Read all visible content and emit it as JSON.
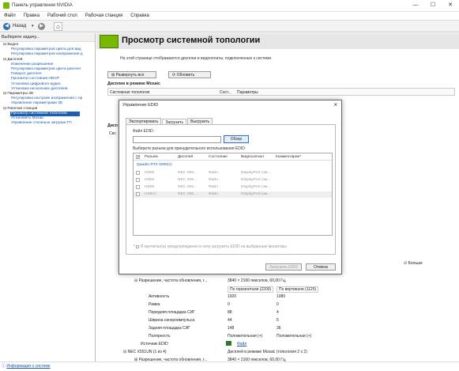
{
  "window": {
    "title": "Панель управления NVIDIA",
    "min": "—",
    "max": "☐",
    "close": "✕"
  },
  "menu": [
    "Файл",
    "Правка",
    "Рабочий стол",
    "Рабочая станция",
    "Справка"
  ],
  "toolbar": {
    "back_label": "Назад"
  },
  "sidebar": {
    "header": "Выберите задачу...",
    "tree": [
      {
        "kind": "cat",
        "label": "⊟ Видео"
      },
      {
        "kind": "item",
        "label": "Регулировка параметров цвета для вид"
      },
      {
        "kind": "item",
        "label": "Регулировка параметров изображения д"
      },
      {
        "kind": "cat",
        "label": "⊟ Дисплей"
      },
      {
        "kind": "item",
        "label": "Изменение разрешения"
      },
      {
        "kind": "item",
        "label": "Регулировка параметров цвета рабочег"
      },
      {
        "kind": "item",
        "label": "Поворот дисплея"
      },
      {
        "kind": "item",
        "label": "Просмотр состояния HDCP"
      },
      {
        "kind": "item",
        "label": "Установка цифрового аудио"
      },
      {
        "kind": "item",
        "label": "Установка нескольких дисплеев"
      },
      {
        "kind": "cat",
        "label": "⊟ Параметры 3D"
      },
      {
        "kind": "item",
        "label": "Регулировка настроек изображения с пр"
      },
      {
        "kind": "item",
        "label": "Управление параметрами 3D"
      },
      {
        "kind": "cat",
        "label": "⊟ Рабочая станция"
      },
      {
        "kind": "sel",
        "label": "Просмотр системной топологии"
      },
      {
        "kind": "item",
        "label": "Установить Mosaic"
      },
      {
        "kind": "item",
        "label": "Управление степенью загрузки ГП"
      }
    ],
    "system_info": "Информация о системе"
  },
  "main": {
    "title": "Просмотр системной топологии",
    "description": "На этой странице отображаются дисплеи и видеоплаты, подключенные к системе.",
    "expand_all": "Развернуть все",
    "refresh": "Обновить",
    "mosaic_section": "Дисплеи в режиме Mosaic",
    "cols": [
      "Системная топология",
      "Сост...",
      "Параметры"
    ],
    "section2_prefix": "Дисп",
    "col2_prefix": "Сис",
    "more": "Больше",
    "rows": [
      {
        "label": "⊟ Разрешение, частота обновления, г...",
        "v1": "3840 × 2160 пикселов, 60,00 Гц,",
        "v2": ""
      },
      {
        "label": "",
        "v1": "По горизонтали (2200)",
        "v2": "По вертикали (1125)"
      },
      {
        "label": "Активность",
        "v1": "1920",
        "v2": "1080"
      },
      {
        "label": "Рамка",
        "v1": "0",
        "v2": "0"
      },
      {
        "label": "Передняя площадка СИГ",
        "v1": "88",
        "v2": "4"
      },
      {
        "label": "Ширина синхроимпульса",
        "v1": "44",
        "v2": "5"
      },
      {
        "label": "Задняя площадка СИГ",
        "v1": "148",
        "v2": "36"
      },
      {
        "label": "Полярность",
        "v1": "Положительная (+)",
        "v2": "Положительная (+)"
      }
    ],
    "edid_source_label": "Источник EDID",
    "edid_source_value": "Файл",
    "monitor_label": "⊟ NEC X551UN (1 из 4)",
    "monitor_value": "Дисплей в режиме Mosaic (топология 2 x 2)",
    "res2_label": "⊞ Разрешение, частота обновления, г...",
    "res2_value": "3840 × 2160 пикселов, 60,00 Гц,"
  },
  "dialog": {
    "title": "Управление EDID",
    "tabs": [
      "Экспортировать",
      "Загрузить",
      "Выгрузить"
    ],
    "active_tab": 1,
    "file_label": "Файл EDID:",
    "browse": "Обзор",
    "select_label": "Выберите разъем для принудительного использования EDID:",
    "headers": [
      "Разъем",
      "Дисплей",
      "Состояние",
      "Видеосигнал",
      "Комментарии*"
    ],
    "gpu": "Quadro RTX 4000(1)",
    "connectors": [
      {
        "port": "HDMI",
        "display": "NEC X55...",
        "state": "Файл",
        "signal": "DisplayPort (эм..."
      },
      {
        "port": "HDMI",
        "display": "NEC X55...",
        "state": "Файл",
        "signal": "DisplayPort (эм..."
      },
      {
        "port": "HDMI",
        "display": "NEC X55...",
        "state": "Файл",
        "signal": "DisplayPort (эм..."
      },
      {
        "port": "USB-C",
        "display": "NEC X55...",
        "state": "Файл",
        "signal": "DisplayPort (эм..."
      }
    ],
    "agree": "Я прочитал(а) предупреждения и хочу загрузить EDID на выбранные мониторы",
    "load_button": "Загрузить EDID",
    "cancel_button": "Отмена"
  }
}
